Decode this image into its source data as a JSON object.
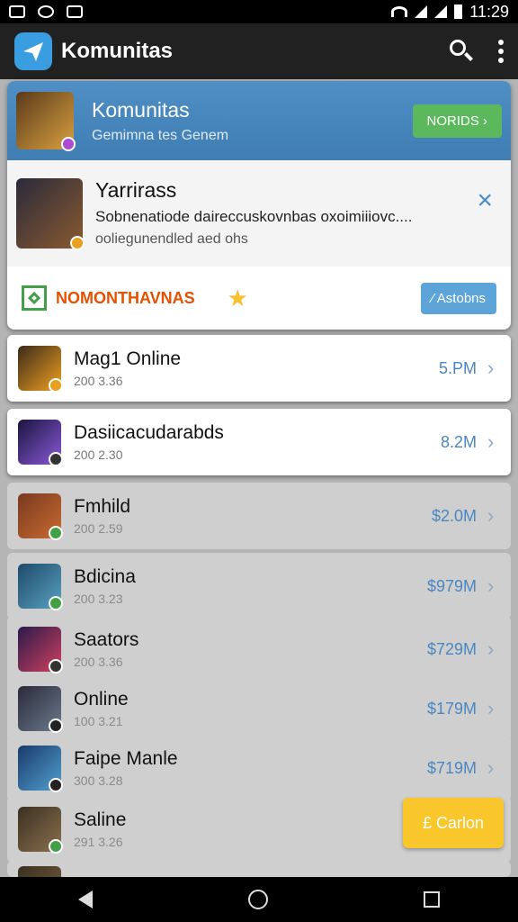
{
  "status": {
    "time": "11:29"
  },
  "app_bar": {
    "title": "Komunitas"
  },
  "banner": {
    "title": "Komunitas",
    "subtitle": "Gemimna tes Genem",
    "button": "NORIDS ›"
  },
  "notice": {
    "title": "Yarrirass",
    "line1": "Sobnenatiode daireccuskovnbas oxoimiiiovc....",
    "line2": "ooliegunendled aed ohs",
    "close_icon": "×"
  },
  "rating": {
    "label": "NOMONTHAVNAS",
    "star": "★",
    "button": "⁄ Astobns"
  },
  "items": [
    {
      "name": "Mag1 Online",
      "meta": "200 3.36",
      "price": "5.PM",
      "colors": [
        "#3b2a1a",
        "#f0a020"
      ],
      "badge": "#e8a020"
    },
    {
      "name": "Dasiicacudarabds",
      "meta": "200 2.30",
      "price": "8.2M",
      "colors": [
        "#1a1440",
        "#8a5ad8"
      ],
      "badge": "#333"
    },
    {
      "name": "Fmhild",
      "meta": "200 2.59",
      "price": "$2.0M",
      "colors": [
        "#7a3a20",
        "#c86a30"
      ],
      "badge": "#43a047"
    },
    {
      "name": "Bdicina",
      "meta": "200 3.23",
      "price": "$979M",
      "colors": [
        "#1e4a6a",
        "#5aa0c0"
      ],
      "badge": "#43a047"
    },
    {
      "name": "Saators",
      "meta": "200 3.36",
      "price": "$729M",
      "colors": [
        "#2a1a4a",
        "#d04060"
      ],
      "badge": "#333"
    },
    {
      "name": "Online",
      "meta": "100 3.21",
      "price": "$179M",
      "colors": [
        "#2a2a3a",
        "#6a7a8a"
      ],
      "badge": "#222"
    },
    {
      "name": "Faipe Manle",
      "meta": "300 3.28",
      "price": "$719M",
      "colors": [
        "#1a3a6a",
        "#50a0d0"
      ],
      "badge": "#222"
    },
    {
      "name": "Saline",
      "meta": "291 3.26",
      "price": "",
      "colors": [
        "#3a3020",
        "#8a7050"
      ],
      "badge": "#43a047"
    },
    {
      "name": "",
      "meta": "",
      "price": "",
      "colors": [
        "#3a3020",
        "#7a6040"
      ],
      "badge": "#43a047"
    }
  ],
  "fab": {
    "label": "£ Carlon"
  }
}
